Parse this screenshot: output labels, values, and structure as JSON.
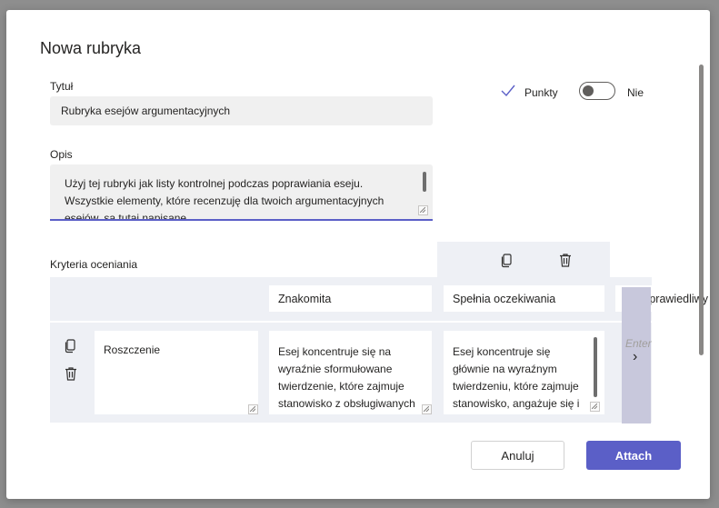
{
  "dialog": {
    "title": "Nowa rubryka",
    "title_label": "Tytuł",
    "title_value": "Rubryka esejów argumentacyjnych",
    "description_label": "Opis",
    "description_value": "Użyj tej rubryki jak listy kontrolnej podczas poprawiania eseju. Wszystkie elementy, które recenzuję dla twoich argumentacyjnych esejów, są tutaj napisane.",
    "points_label": "Punkty",
    "points_toggle_state": "Nie",
    "criteria_label": "Kryteria oceniania",
    "levels": [
      "Znakomita",
      "Spełnia oczekiwania",
      "Sprawiedliwy"
    ],
    "criteria": [
      {
        "name": "Roszczenie",
        "descriptions": [
          "Esej koncentruje się na wyraźnie sformułowane twierdzenie, które zajmuje stanowisko z obsługiwanych wyników",
          "Esej koncentruje się głównie na wyraźnym twierdzeniu, które zajmuje stanowisko, angażuje się i kształci na dany temat."
        ],
        "next_placeholder": "Enter"
      }
    ],
    "cancel_label": "Anuluj",
    "attach_label": "Attach"
  },
  "icons": {
    "points_check": "check-icon",
    "copy": "copy-icon",
    "delete": "trash-icon",
    "next": "chevron-right-icon"
  },
  "colors": {
    "accent": "#5b5fc7",
    "band": "#eef0f5"
  }
}
